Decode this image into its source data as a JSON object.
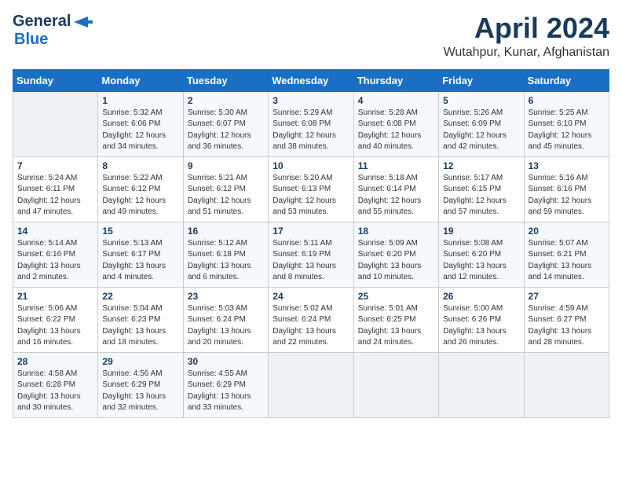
{
  "logo": {
    "line1": "General",
    "line2": "Blue",
    "arrow": "▶"
  },
  "title": "April 2024",
  "location": "Wutahpur, Kunar, Afghanistan",
  "weekdays": [
    "Sunday",
    "Monday",
    "Tuesday",
    "Wednesday",
    "Thursday",
    "Friday",
    "Saturday"
  ],
  "weeks": [
    [
      {
        "day": "",
        "content": ""
      },
      {
        "day": "1",
        "content": "Sunrise: 5:32 AM\nSunset: 6:06 PM\nDaylight: 12 hours\nand 34 minutes."
      },
      {
        "day": "2",
        "content": "Sunrise: 5:30 AM\nSunset: 6:07 PM\nDaylight: 12 hours\nand 36 minutes."
      },
      {
        "day": "3",
        "content": "Sunrise: 5:29 AM\nSunset: 6:08 PM\nDaylight: 12 hours\nand 38 minutes."
      },
      {
        "day": "4",
        "content": "Sunrise: 5:28 AM\nSunset: 6:08 PM\nDaylight: 12 hours\nand 40 minutes."
      },
      {
        "day": "5",
        "content": "Sunrise: 5:26 AM\nSunset: 6:09 PM\nDaylight: 12 hours\nand 42 minutes."
      },
      {
        "day": "6",
        "content": "Sunrise: 5:25 AM\nSunset: 6:10 PM\nDaylight: 12 hours\nand 45 minutes."
      }
    ],
    [
      {
        "day": "7",
        "content": "Sunrise: 5:24 AM\nSunset: 6:11 PM\nDaylight: 12 hours\nand 47 minutes."
      },
      {
        "day": "8",
        "content": "Sunrise: 5:22 AM\nSunset: 6:12 PM\nDaylight: 12 hours\nand 49 minutes."
      },
      {
        "day": "9",
        "content": "Sunrise: 5:21 AM\nSunset: 6:12 PM\nDaylight: 12 hours\nand 51 minutes."
      },
      {
        "day": "10",
        "content": "Sunrise: 5:20 AM\nSunset: 6:13 PM\nDaylight: 12 hours\nand 53 minutes."
      },
      {
        "day": "11",
        "content": "Sunrise: 5:18 AM\nSunset: 6:14 PM\nDaylight: 12 hours\nand 55 minutes."
      },
      {
        "day": "12",
        "content": "Sunrise: 5:17 AM\nSunset: 6:15 PM\nDaylight: 12 hours\nand 57 minutes."
      },
      {
        "day": "13",
        "content": "Sunrise: 5:16 AM\nSunset: 6:16 PM\nDaylight: 12 hours\nand 59 minutes."
      }
    ],
    [
      {
        "day": "14",
        "content": "Sunrise: 5:14 AM\nSunset: 6:16 PM\nDaylight: 13 hours\nand 2 minutes."
      },
      {
        "day": "15",
        "content": "Sunrise: 5:13 AM\nSunset: 6:17 PM\nDaylight: 13 hours\nand 4 minutes."
      },
      {
        "day": "16",
        "content": "Sunrise: 5:12 AM\nSunset: 6:18 PM\nDaylight: 13 hours\nand 6 minutes."
      },
      {
        "day": "17",
        "content": "Sunrise: 5:11 AM\nSunset: 6:19 PM\nDaylight: 13 hours\nand 8 minutes."
      },
      {
        "day": "18",
        "content": "Sunrise: 5:09 AM\nSunset: 6:20 PM\nDaylight: 13 hours\nand 10 minutes."
      },
      {
        "day": "19",
        "content": "Sunrise: 5:08 AM\nSunset: 6:20 PM\nDaylight: 13 hours\nand 12 minutes."
      },
      {
        "day": "20",
        "content": "Sunrise: 5:07 AM\nSunset: 6:21 PM\nDaylight: 13 hours\nand 14 minutes."
      }
    ],
    [
      {
        "day": "21",
        "content": "Sunrise: 5:06 AM\nSunset: 6:22 PM\nDaylight: 13 hours\nand 16 minutes."
      },
      {
        "day": "22",
        "content": "Sunrise: 5:04 AM\nSunset: 6:23 PM\nDaylight: 13 hours\nand 18 minutes."
      },
      {
        "day": "23",
        "content": "Sunrise: 5:03 AM\nSunset: 6:24 PM\nDaylight: 13 hours\nand 20 minutes."
      },
      {
        "day": "24",
        "content": "Sunrise: 5:02 AM\nSunset: 6:24 PM\nDaylight: 13 hours\nand 22 minutes."
      },
      {
        "day": "25",
        "content": "Sunrise: 5:01 AM\nSunset: 6:25 PM\nDaylight: 13 hours\nand 24 minutes."
      },
      {
        "day": "26",
        "content": "Sunrise: 5:00 AM\nSunset: 6:26 PM\nDaylight: 13 hours\nand 26 minutes."
      },
      {
        "day": "27",
        "content": "Sunrise: 4:59 AM\nSunset: 6:27 PM\nDaylight: 13 hours\nand 28 minutes."
      }
    ],
    [
      {
        "day": "28",
        "content": "Sunrise: 4:58 AM\nSunset: 6:28 PM\nDaylight: 13 hours\nand 30 minutes."
      },
      {
        "day": "29",
        "content": "Sunrise: 4:56 AM\nSunset: 6:29 PM\nDaylight: 13 hours\nand 32 minutes."
      },
      {
        "day": "30",
        "content": "Sunrise: 4:55 AM\nSunset: 6:29 PM\nDaylight: 13 hours\nand 33 minutes."
      },
      {
        "day": "",
        "content": ""
      },
      {
        "day": "",
        "content": ""
      },
      {
        "day": "",
        "content": ""
      },
      {
        "day": "",
        "content": ""
      }
    ]
  ]
}
